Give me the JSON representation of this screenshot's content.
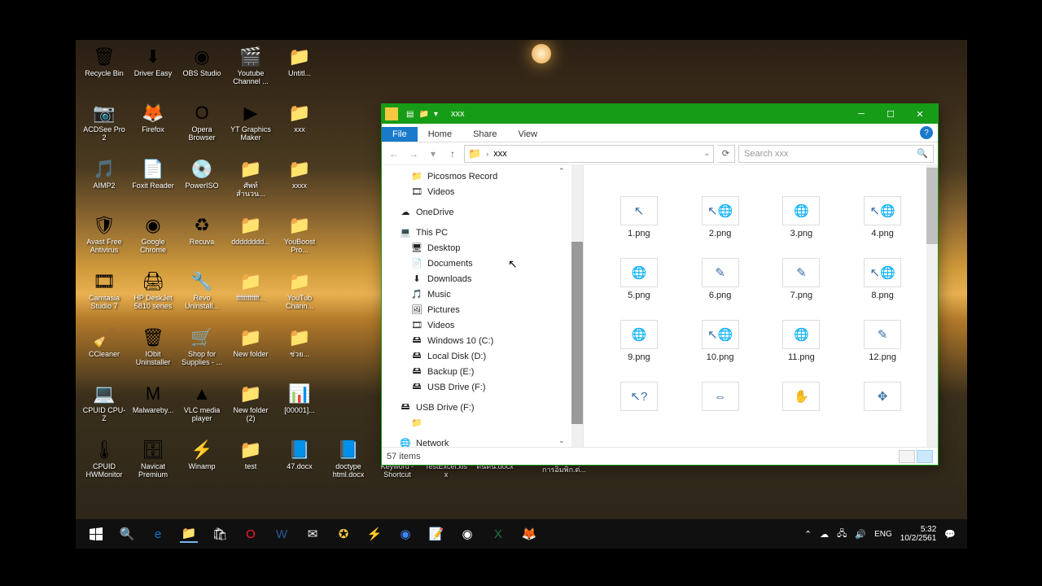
{
  "desktop": {
    "rows": [
      [
        {
          "label": "Recycle Bin",
          "glyph": "🗑"
        },
        {
          "label": "Driver Easy",
          "glyph": "⬇"
        },
        {
          "label": "OBS Studio",
          "glyph": "◉"
        },
        {
          "label": "Youtube Channel ...",
          "glyph": "🎬"
        },
        {
          "label": "Untitl...",
          "glyph": "📁"
        }
      ],
      [
        {
          "label": "ACDSee Pro 2",
          "glyph": "📷"
        },
        {
          "label": "Firefox",
          "glyph": "🦊"
        },
        {
          "label": "Opera Browser",
          "glyph": "O"
        },
        {
          "label": "YT Graphics Maker",
          "glyph": "▶"
        },
        {
          "label": "xxx",
          "glyph": "📁"
        }
      ],
      [
        {
          "label": "AIMP2",
          "glyph": "🎵"
        },
        {
          "label": "Foxit Reader",
          "glyph": "📄"
        },
        {
          "label": "PowerISO",
          "glyph": "💿"
        },
        {
          "label": "ศัพท์ สำนวน...",
          "glyph": "📁"
        },
        {
          "label": "xxxx",
          "glyph": "📁"
        }
      ],
      [
        {
          "label": "Avast Free Antivirus",
          "glyph": "🛡"
        },
        {
          "label": "Google Chrome",
          "glyph": "◉"
        },
        {
          "label": "Recuva",
          "glyph": "♻"
        },
        {
          "label": "dddddddd...",
          "glyph": "📁"
        },
        {
          "label": "YouBoost Pro...",
          "glyph": "📁"
        }
      ],
      [
        {
          "label": "Camtasia Studio 7",
          "glyph": "🎞"
        },
        {
          "label": "HP DeskJet 5810 series",
          "glyph": "🖨"
        },
        {
          "label": "Revo Uninstall...",
          "glyph": "🔧"
        },
        {
          "label": "ffffffffffff...",
          "glyph": "📁"
        },
        {
          "label": "YouTub Chann...",
          "glyph": "📁"
        }
      ],
      [
        {
          "label": "CCleaner",
          "glyph": "🧹"
        },
        {
          "label": "IObit Uninstaller",
          "glyph": "🗑"
        },
        {
          "label": "Shop for Supplies - ...",
          "glyph": "🛒"
        },
        {
          "label": "New folder",
          "glyph": "📁"
        },
        {
          "label": "ช่วย...",
          "glyph": "📁"
        }
      ],
      [
        {
          "label": "CPUID CPU-Z",
          "glyph": "💻"
        },
        {
          "label": "Malwareby...",
          "glyph": "M"
        },
        {
          "label": "VLC media player",
          "glyph": "▲"
        },
        {
          "label": "New folder (2)",
          "glyph": "📁"
        },
        {
          "label": "[00001]...",
          "glyph": "📊"
        }
      ],
      [
        {
          "label": "CPUID HWMonitor",
          "glyph": "🌡"
        },
        {
          "label": "Navicat Premium",
          "glyph": "🗄"
        },
        {
          "label": "Winamp",
          "glyph": "⚡"
        },
        {
          "label": "test",
          "glyph": "📁"
        },
        {
          "label": "47.docx",
          "glyph": "📘"
        },
        {
          "label": "doctype html.docx",
          "glyph": "📘"
        },
        {
          "label": "Keyword - Shortcut",
          "glyph": "📘"
        },
        {
          "label": "TestExcel.xlsx",
          "glyph": "📗"
        },
        {
          "label": "ตันตัน.docx",
          "glyph": "📘"
        }
      ]
    ]
  },
  "explorer": {
    "title": "xxx",
    "tabs": {
      "file": "File",
      "home": "Home",
      "share": "Share",
      "view": "View"
    },
    "breadcrumb": {
      "sep": "›",
      "folder": "xxx"
    },
    "search_placeholder": "Search xxx",
    "nav": [
      {
        "label": "Picosmos Record",
        "icon": "📁",
        "lvl": 2
      },
      {
        "label": "Videos",
        "icon": "🎞",
        "lvl": 2
      },
      {
        "label": "OneDrive",
        "icon": "☁",
        "lvl": 1,
        "spacer": true
      },
      {
        "label": "This PC",
        "icon": "💻",
        "lvl": 1,
        "spacer": true
      },
      {
        "label": "Desktop",
        "icon": "🖥",
        "lvl": 2
      },
      {
        "label": "Documents",
        "icon": "📄",
        "lvl": 2
      },
      {
        "label": "Downloads",
        "icon": "⬇",
        "lvl": 2
      },
      {
        "label": "Music",
        "icon": "🎵",
        "lvl": 2
      },
      {
        "label": "Pictures",
        "icon": "🖼",
        "lvl": 2
      },
      {
        "label": "Videos",
        "icon": "🎞",
        "lvl": 2
      },
      {
        "label": "Windows 10 (C:)",
        "icon": "🖴",
        "lvl": 2
      },
      {
        "label": "Local Disk (D:)",
        "icon": "🖴",
        "lvl": 2
      },
      {
        "label": "Backup (E:)",
        "icon": "🖴",
        "lvl": 2
      },
      {
        "label": "USB Drive (F:)",
        "icon": "🖴",
        "lvl": 2
      },
      {
        "label": "USB Drive (F:)",
        "icon": "🖴",
        "lvl": 1,
        "spacer": true
      },
      {
        "label": "",
        "icon": "📁",
        "lvl": 2
      },
      {
        "label": "Network",
        "icon": "🌐",
        "lvl": 1,
        "spacer": true
      }
    ],
    "files": [
      {
        "name": "1.png",
        "thumb": "↖"
      },
      {
        "name": "2.png",
        "thumb": "↖🌐"
      },
      {
        "name": "3.png",
        "thumb": "🌐"
      },
      {
        "name": "4.png",
        "thumb": "↖🌐"
      },
      {
        "name": "5.png",
        "thumb": "🌐"
      },
      {
        "name": "6.png",
        "thumb": "✎"
      },
      {
        "name": "7.png",
        "thumb": "✎"
      },
      {
        "name": "8.png",
        "thumb": "↖🌐"
      },
      {
        "name": "9.png",
        "thumb": "🌐"
      },
      {
        "name": "10.png",
        "thumb": "↖🌐"
      },
      {
        "name": "11.png",
        "thumb": "🌐"
      },
      {
        "name": "12.png",
        "thumb": "✎"
      },
      {
        "name": "",
        "thumb": "↖?"
      },
      {
        "name": "",
        "thumb": "⇔"
      },
      {
        "name": "",
        "thumb": "✋"
      },
      {
        "name": "",
        "thumb": "✥"
      }
    ],
    "status": "57 items"
  },
  "thai_below_window": "การอิมพิก.ต่...",
  "taskbar": {
    "lang": "ENG",
    "time": "5:32",
    "date": "10/2/2561"
  }
}
